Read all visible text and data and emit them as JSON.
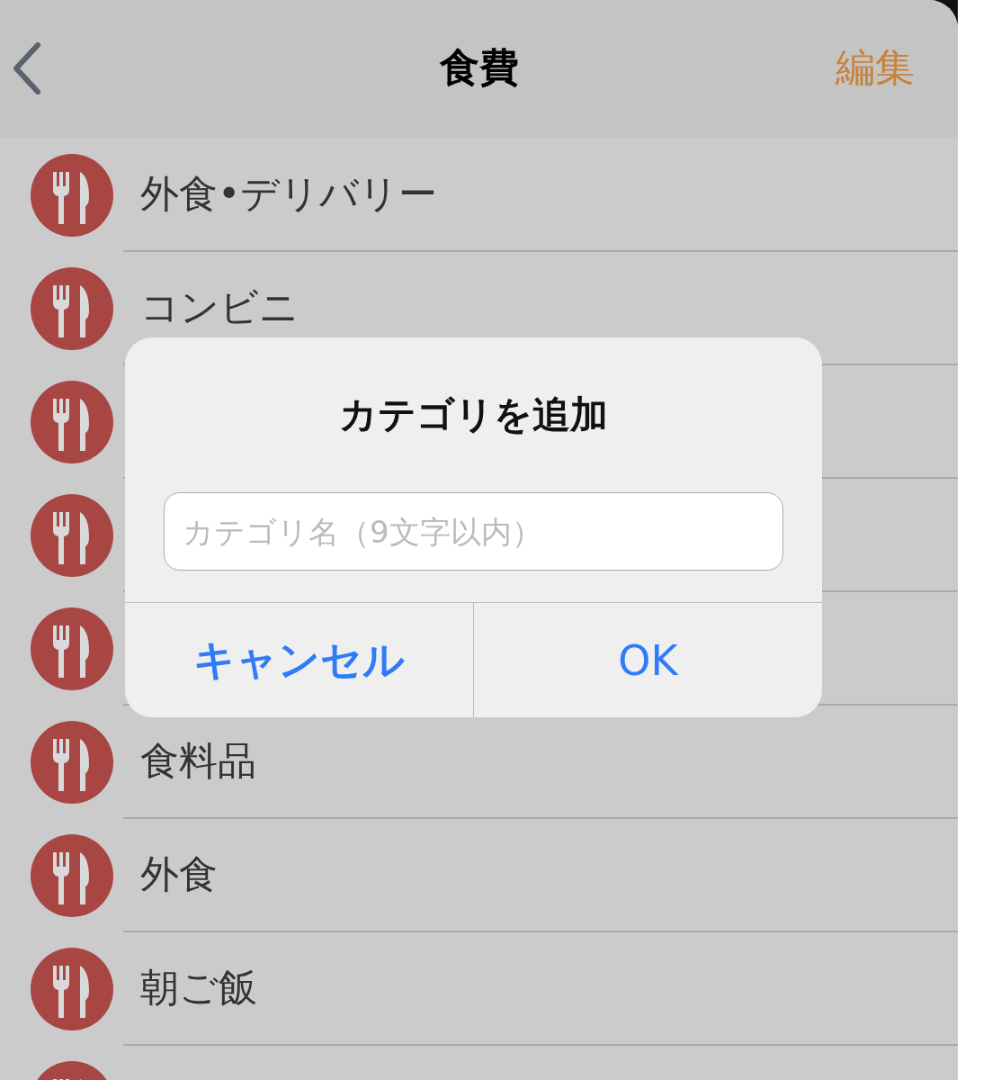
{
  "nav": {
    "title": "食費",
    "action": "編集"
  },
  "categories": [
    {
      "kind": "category",
      "label": "外食•デリバリー"
    },
    {
      "kind": "category",
      "label": "コンビニ"
    },
    {
      "kind": "covered"
    },
    {
      "kind": "covered"
    },
    {
      "kind": "covered"
    },
    {
      "kind": "category",
      "label": "食料品"
    },
    {
      "kind": "category",
      "label": "外食"
    },
    {
      "kind": "category",
      "label": "朝ご飯"
    },
    {
      "kind": "covered"
    }
  ],
  "dialog": {
    "title": "カテゴリを追加",
    "field": {
      "placeholder": "カテゴリ名（9文字以内）"
    },
    "buttons": [
      {
        "label": "キャンセル",
        "kind": "cancel"
      },
      {
        "label": "OK",
        "kind": "default"
      }
    ]
  }
}
